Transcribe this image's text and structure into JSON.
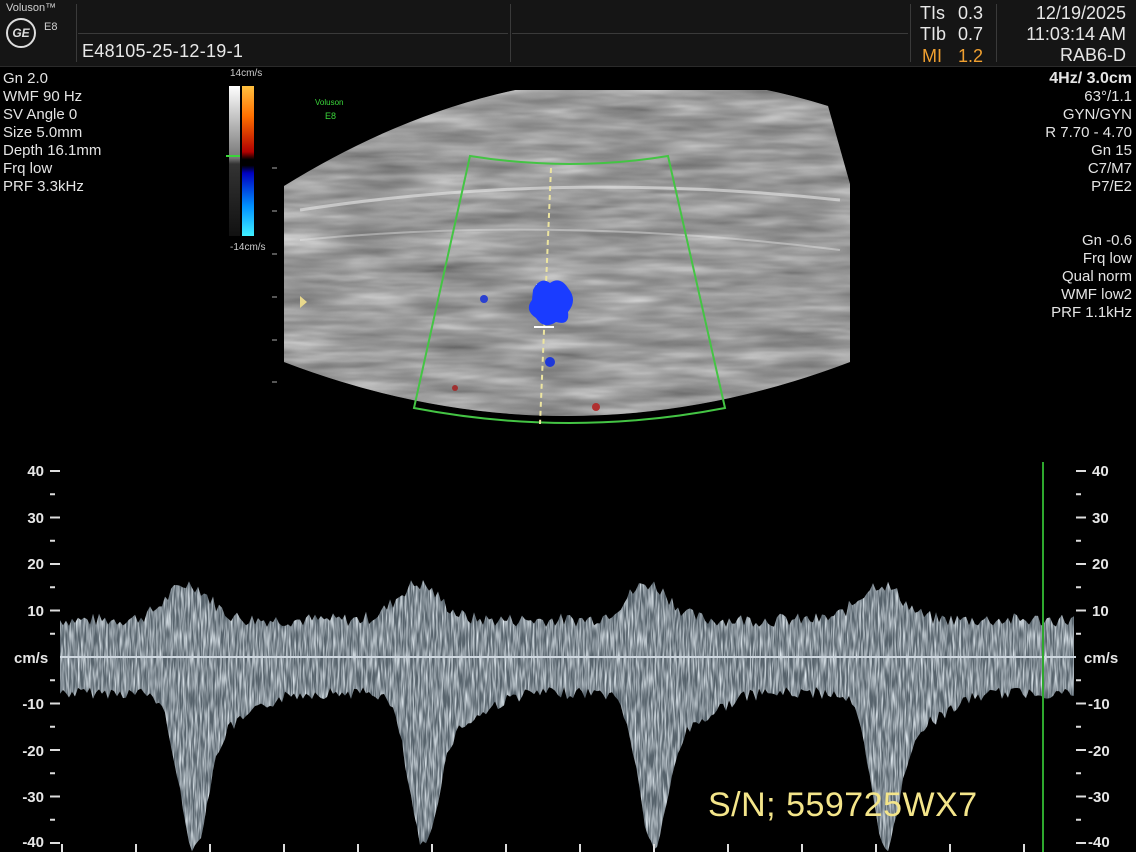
{
  "header": {
    "brand": "Voluson™",
    "logo_text": "GE",
    "model": "E8",
    "patient_id": "E48105-25-12-19-1",
    "indices": [
      {
        "label": "TIs",
        "value": "0.3"
      },
      {
        "label": "TIb",
        "value": "0.7"
      },
      {
        "label": "MI",
        "value": "1.2"
      }
    ],
    "date": "12/19/2025",
    "time": "11:03:14 AM",
    "probe": "RAB6-D"
  },
  "left_params": [
    "Gn  2.0",
    "WMF 90 Hz",
    "SV Angle  0",
    "Size  5.0mm",
    "Depth 16.1mm",
    "Frq low",
    "PRF  3.3kHz"
  ],
  "right_params_image": [
    "4Hz/ 3.0cm",
    "63°/1.1",
    "GYN/GYN",
    "R 7.70 - 4.70",
    "Gn  15",
    "C7/M7",
    "P7/E2"
  ],
  "right_params_doppler": [
    "Gn -0.6",
    "Frq low",
    "Qual norm",
    "WMF low2",
    "PRF  1.1kHz"
  ],
  "color_bar": {
    "top_label": "14cm/s",
    "bottom_label": "-14cm/s"
  },
  "image_watermark": {
    "line1": "Voluson",
    "line2": "E8"
  },
  "doppler": {
    "unit": "cm/s",
    "tick_labels": [
      "40",
      "30",
      "20",
      "10",
      "-10",
      "-20",
      "-30",
      "-40"
    ]
  },
  "serial": "S/N; 559725WX7",
  "colors": {
    "overlay_green": "#44c444",
    "mi_orange": "#f0a030",
    "serial_yellow": "#f4e58a",
    "flow_blue": "#1a3cff"
  }
}
